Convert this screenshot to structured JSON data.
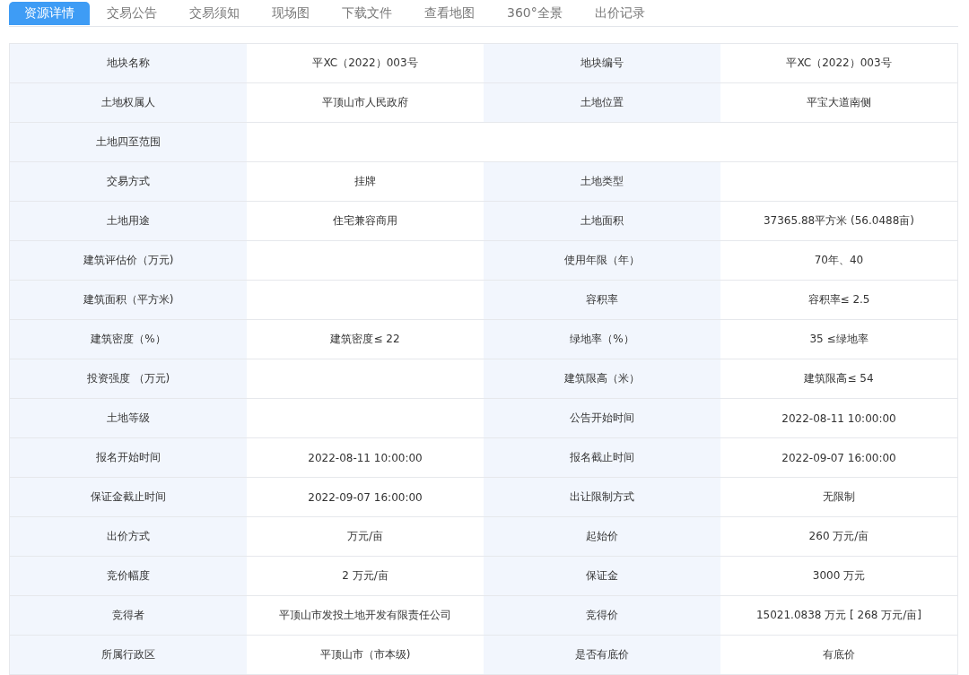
{
  "tabs": [
    {
      "label": "资源详情",
      "selected": true
    },
    {
      "label": "交易公告",
      "selected": false
    },
    {
      "label": "交易须知",
      "selected": false
    },
    {
      "label": "现场图",
      "selected": false
    },
    {
      "label": "下载文件",
      "selected": false
    },
    {
      "label": "查看地图",
      "selected": false
    },
    {
      "label": "360°全景",
      "selected": false
    },
    {
      "label": "出价记录",
      "selected": false
    }
  ],
  "rows": [
    {
      "cells": [
        {
          "label": "地块名称",
          "value": "平XC（2022）003号"
        },
        {
          "label": "地块编号",
          "value": "平XC（2022）003号"
        }
      ]
    },
    {
      "cells": [
        {
          "label": "土地权属人",
          "value": "平顶山市人民政府"
        },
        {
          "label": "土地位置",
          "value": "平宝大道南侧"
        }
      ]
    },
    {
      "cells": [
        {
          "label": "土地四至范围"
        }
      ]
    },
    {
      "cells": [
        {
          "label": "交易方式",
          "value": "挂牌"
        },
        {
          "label": "土地类型"
        }
      ]
    },
    {
      "cells": [
        {
          "label": "土地用途",
          "value": "住宅兼容商用"
        },
        {
          "label": "土地面积",
          "value": "37365.88平方米 (56.0488亩)"
        }
      ]
    },
    {
      "cells": [
        {
          "label": "建筑评估价（万元)"
        },
        {
          "label": "使用年限（年）",
          "value": "70年、40"
        }
      ]
    },
    {
      "cells": [
        {
          "label": "建筑面积（平方米)"
        },
        {
          "label": "容积率",
          "value": "容积率≤ 2.5"
        }
      ]
    },
    {
      "cells": [
        {
          "label": "建筑密度（%）",
          "value": "建筑密度≤ 22"
        },
        {
          "label": "绿地率（%）",
          "value": "35 ≤绿地率"
        }
      ]
    },
    {
      "cells": [
        {
          "label": "投资强度 （万元)"
        },
        {
          "label": "建筑限高（米）",
          "value": "建筑限高≤ 54"
        }
      ]
    },
    {
      "cells": [
        {
          "label": "土地等级"
        },
        {
          "label": "公告开始时间",
          "value": "2022-08-11 10:00:00"
        }
      ]
    },
    {
      "cells": [
        {
          "label": "报名开始时间",
          "value": "2022-08-11 10:00:00"
        },
        {
          "label": "报名截止时间",
          "value": "2022-09-07 16:00:00"
        }
      ]
    },
    {
      "cells": [
        {
          "label": "保证金截止时间",
          "value": "2022-09-07 16:00:00"
        },
        {
          "label": "出让限制方式",
          "value": "无限制"
        }
      ]
    },
    {
      "cells": [
        {
          "label": "出价方式",
          "value": "万元/亩"
        },
        {
          "label": "起始价",
          "value": "260 万元/亩"
        }
      ]
    },
    {
      "cells": [
        {
          "label": "竞价幅度",
          "value": "2 万元/亩"
        },
        {
          "label": "保证金",
          "value": "3000 万元"
        }
      ]
    },
    {
      "cells": [
        {
          "label": "竞得者",
          "value": "平顶山市发投土地开发有限责任公司"
        },
        {
          "label": "竞得价",
          "value": "15021.0838 万元 [ 268 万元/亩]"
        }
      ]
    },
    {
      "cells": [
        {
          "label": "所属行政区",
          "value": "平顶山市（市本级)"
        },
        {
          "label": "是否有底价",
          "value": "有底价"
        }
      ]
    }
  ]
}
